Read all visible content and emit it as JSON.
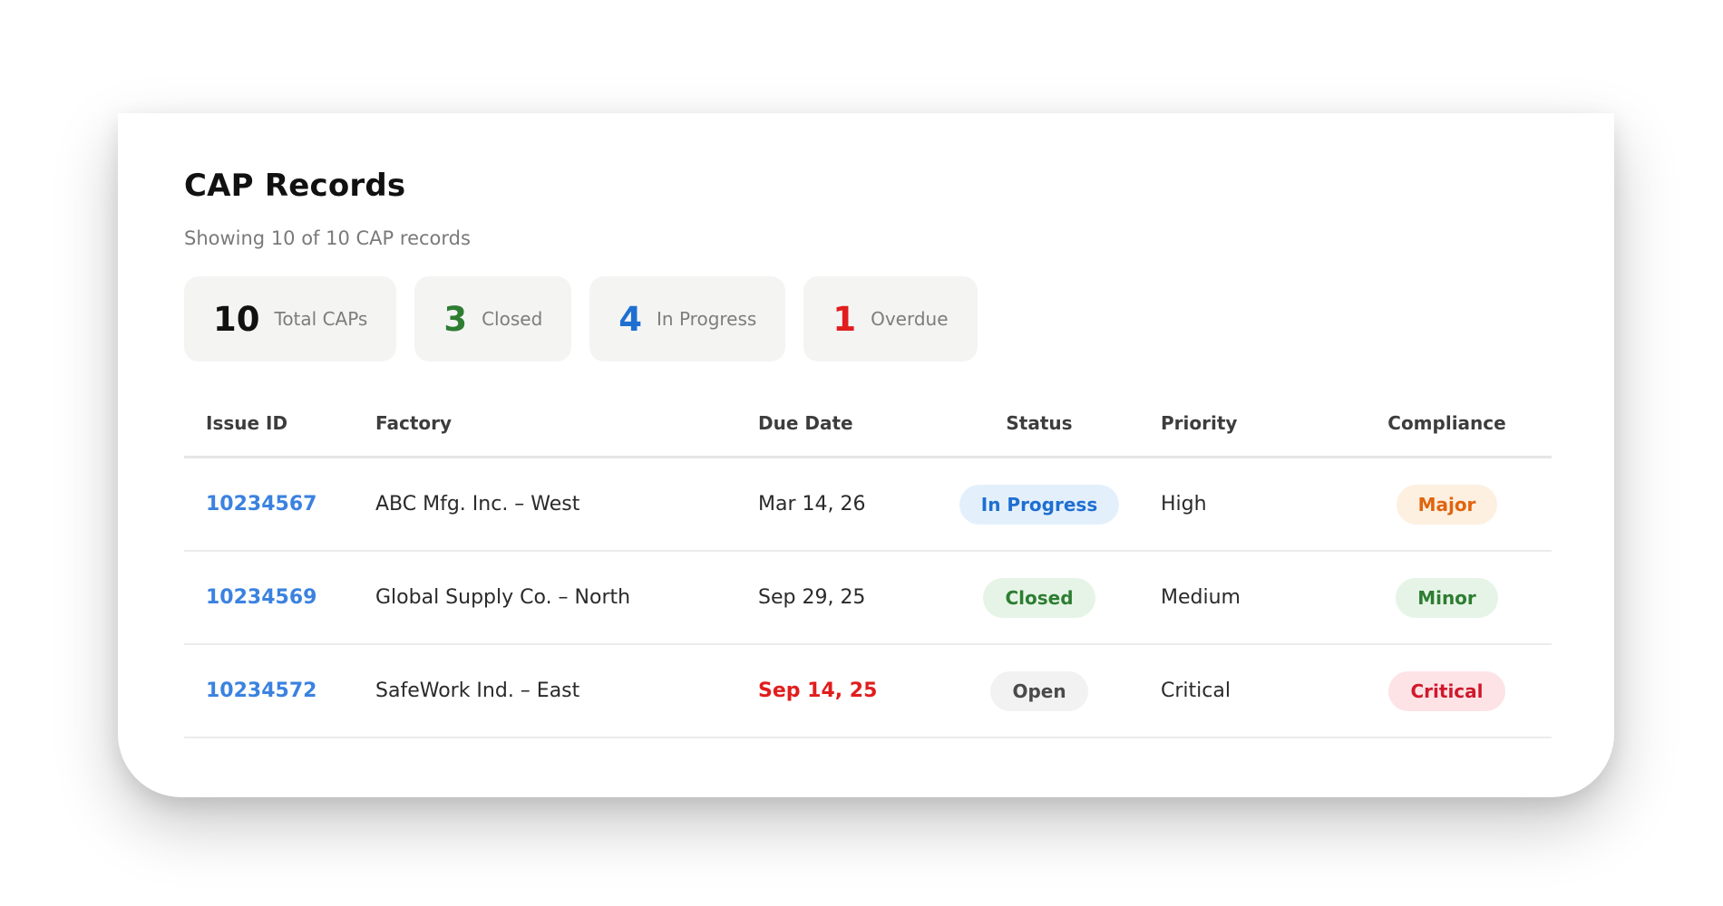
{
  "header": {
    "title": "CAP Records",
    "subtitle": "Showing 10 of 10 CAP records"
  },
  "stats": [
    {
      "value": "10",
      "label": "Total CAPs",
      "color": "#111111"
    },
    {
      "value": "3",
      "label": "Closed",
      "color": "#2e7d32"
    },
    {
      "value": "4",
      "label": "In Progress",
      "color": "#1f6fd1"
    },
    {
      "value": "1",
      "label": "Overdue",
      "color": "#e11d1d"
    }
  ],
  "table": {
    "columns": [
      "Issue ID",
      "Factory",
      "Due Date",
      "Status",
      "Priority",
      "Compliance"
    ],
    "rows": [
      {
        "issue_id": "10234567",
        "factory": "ABC Mfg. Inc. – West",
        "due_date": "Mar 14, 26",
        "due_overdue": false,
        "status": "In Progress",
        "priority": "High",
        "compliance": "Major"
      },
      {
        "issue_id": "10234569",
        "factory": "Global Supply Co. – North",
        "due_date": "Sep 29, 25",
        "due_overdue": false,
        "status": "Closed",
        "priority": "Medium",
        "compliance": "Minor"
      },
      {
        "issue_id": "10234572",
        "factory": "SafeWork Ind. – East",
        "due_date": "Sep 14, 25",
        "due_overdue": true,
        "status": "Open",
        "priority": "Critical",
        "compliance": "Critical"
      }
    ]
  },
  "colors": {
    "link": "#3b82e0",
    "overdue": "#e11d1d",
    "status_in_progress_bg": "#e3f0fc",
    "status_in_progress_fg": "#1f6fd1",
    "status_closed_bg": "#e6f4e7",
    "status_closed_fg": "#2e7d32",
    "status_open_bg": "#f2f2f2",
    "status_open_fg": "#4a4a4a",
    "comp_major_bg": "#fdf0e0",
    "comp_major_fg": "#e0650e",
    "comp_minor_bg": "#e6f4e7",
    "comp_minor_fg": "#2e7d32",
    "comp_critical_bg": "#fde3e6",
    "comp_critical_fg": "#d1182b"
  }
}
